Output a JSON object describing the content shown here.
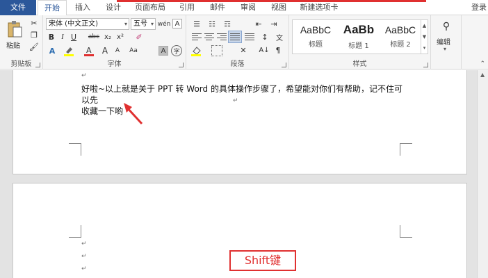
{
  "tabs": {
    "file": "文件",
    "home": "开始",
    "insert": "插入",
    "design": "设计",
    "layout": "页面布局",
    "references": "引用",
    "mailings": "邮件",
    "review": "审阅",
    "view": "视图",
    "new_tab": "新建选项卡",
    "login": "登录"
  },
  "ribbon": {
    "clipboard": {
      "paste_label": "粘贴",
      "group_label": "剪贴板"
    },
    "font": {
      "font_name": "宋体 (中文正文)",
      "font_size": "五号",
      "bold": "B",
      "italic": "I",
      "underline": "U",
      "strike": "abc",
      "subscript": "x₂",
      "superscript": "x²",
      "group_label": "字体"
    },
    "paragraph": {
      "group_label": "段落"
    },
    "styles": {
      "group_label": "样式",
      "items": [
        {
          "sample": "AaBbC",
          "name": "标题"
        },
        {
          "sample": "AaBb",
          "name": "标题 1"
        },
        {
          "sample": "AaBbC",
          "name": "标题 2"
        }
      ]
    },
    "editing": {
      "label": "编辑"
    }
  },
  "document": {
    "paragraph_line1": "好啦~以上就是关于 PPT 转 Word 的具体操作步骤了，希望能对你们有帮助，记不住可以先",
    "paragraph_line2": "收藏一下哟",
    "annotation": "Shift键"
  },
  "colors": {
    "accent": "#2b579a",
    "highlight_red": "#e03030"
  }
}
